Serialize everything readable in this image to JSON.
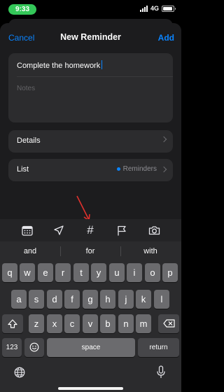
{
  "status_bar": {
    "time": "9:33",
    "network": "4G",
    "battery_level": 0.9
  },
  "nav": {
    "cancel_label": "Cancel",
    "title": "New Reminder",
    "add_label": "Add"
  },
  "form": {
    "title_value": "Complete the homework",
    "notes_placeholder": "Notes",
    "details_label": "Details",
    "list_label": "List",
    "list_value": "Reminders"
  },
  "toolbar": {
    "icons": [
      "calendar-icon",
      "location-arrow-icon",
      "hashtag-icon",
      "flag-icon",
      "camera-icon"
    ],
    "hash_glyph": "#"
  },
  "keyboard": {
    "suggestions": [
      "and",
      "for",
      "with"
    ],
    "row1": [
      "q",
      "w",
      "e",
      "r",
      "t",
      "y",
      "u",
      "i",
      "o",
      "p"
    ],
    "row2": [
      "a",
      "s",
      "d",
      "f",
      "g",
      "h",
      "j",
      "k",
      "l"
    ],
    "row3": [
      "z",
      "x",
      "c",
      "v",
      "b",
      "n",
      "m"
    ],
    "numbers_label": "123",
    "space_label": "space",
    "return_label": "return"
  },
  "colors": {
    "accent": "#0a84ff",
    "time_pill": "#34c759",
    "annotation_arrow": "#e0312e"
  }
}
